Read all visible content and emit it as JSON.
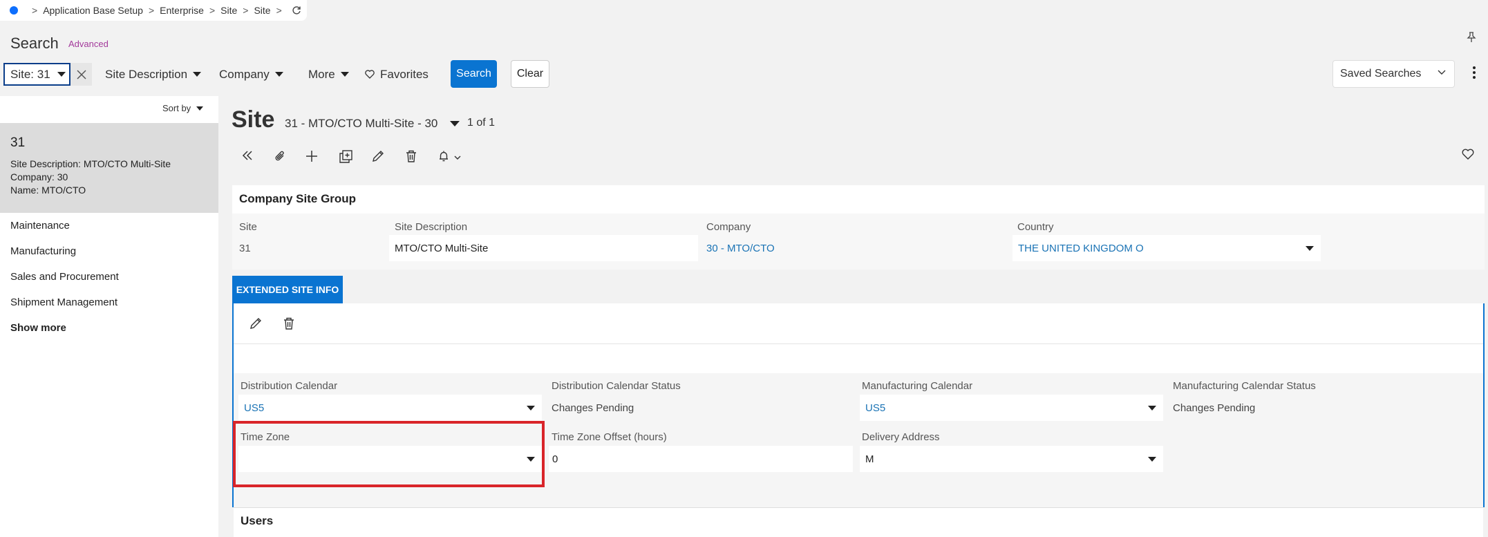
{
  "breadcrumb": {
    "items": [
      "Application Base Setup",
      "Enterprise",
      "Site",
      "Site"
    ]
  },
  "search": {
    "title": "Search",
    "advanced_label": "Advanced",
    "filters": {
      "site_chip": "Site: 31",
      "site_description": "Site Description",
      "company": "Company",
      "more": "More",
      "favorites": "Favorites"
    },
    "search_button": "Search",
    "clear_button": "Clear",
    "saved_searches": "Saved Searches"
  },
  "list": {
    "sort_by": "Sort by",
    "record": {
      "id": "31",
      "site_description_line": "Site Description:   MTO/CTO Multi-Site",
      "company_line": "Company:   30",
      "name_line": "Name:   MTO/CTO"
    },
    "nav": [
      "Maintenance",
      "Manufacturing",
      "Sales and Procurement",
      "Shipment Management"
    ],
    "show_more": "Show more"
  },
  "main": {
    "page_title": "Site",
    "record_title": "31 - MTO/CTO Multi-Site - 30",
    "record_count": "1 of 1",
    "group": {
      "title": "Company Site Group",
      "site_label": "Site",
      "site_value": "31",
      "site_desc_label": "Site Description",
      "site_desc_value": "MTO/CTO Multi-Site",
      "company_label": "Company",
      "company_value": "30 - MTO/CTO",
      "country_label": "Country",
      "country_value": "THE UNITED KINGDOM O"
    },
    "tab_label": "EXTENDED SITE INFO",
    "ext": {
      "dist_cal_label": "Distribution Calendar",
      "dist_cal_value": "US5",
      "dist_cal_status_label": "Distribution Calendar Status",
      "dist_cal_status_value": "Changes Pending",
      "mfg_cal_label": "Manufacturing Calendar",
      "mfg_cal_value": "US5",
      "mfg_cal_status_label": "Manufacturing Calendar Status",
      "mfg_cal_status_value": "Changes Pending",
      "tz_label": "Time Zone",
      "tz_value": "",
      "tz_offset_label": "Time Zone Offset (hours)",
      "tz_offset_value": "0",
      "delivery_label": "Delivery Address",
      "delivery_value": "M"
    },
    "users_title": "Users"
  },
  "colors": {
    "accent": "#0a74d1",
    "link": "#1a73b5",
    "highlight": "#d9252a",
    "advanced": "#a33a9b"
  },
  "icons": [
    "home-dot-icon",
    "refresh-icon",
    "pin-icon",
    "close-icon",
    "heart-icon",
    "kebab-icon",
    "collapse-icon",
    "paperclip-icon",
    "plus-icon",
    "duplicate-icon",
    "pencil-icon",
    "trash-icon",
    "bell-icon"
  ]
}
